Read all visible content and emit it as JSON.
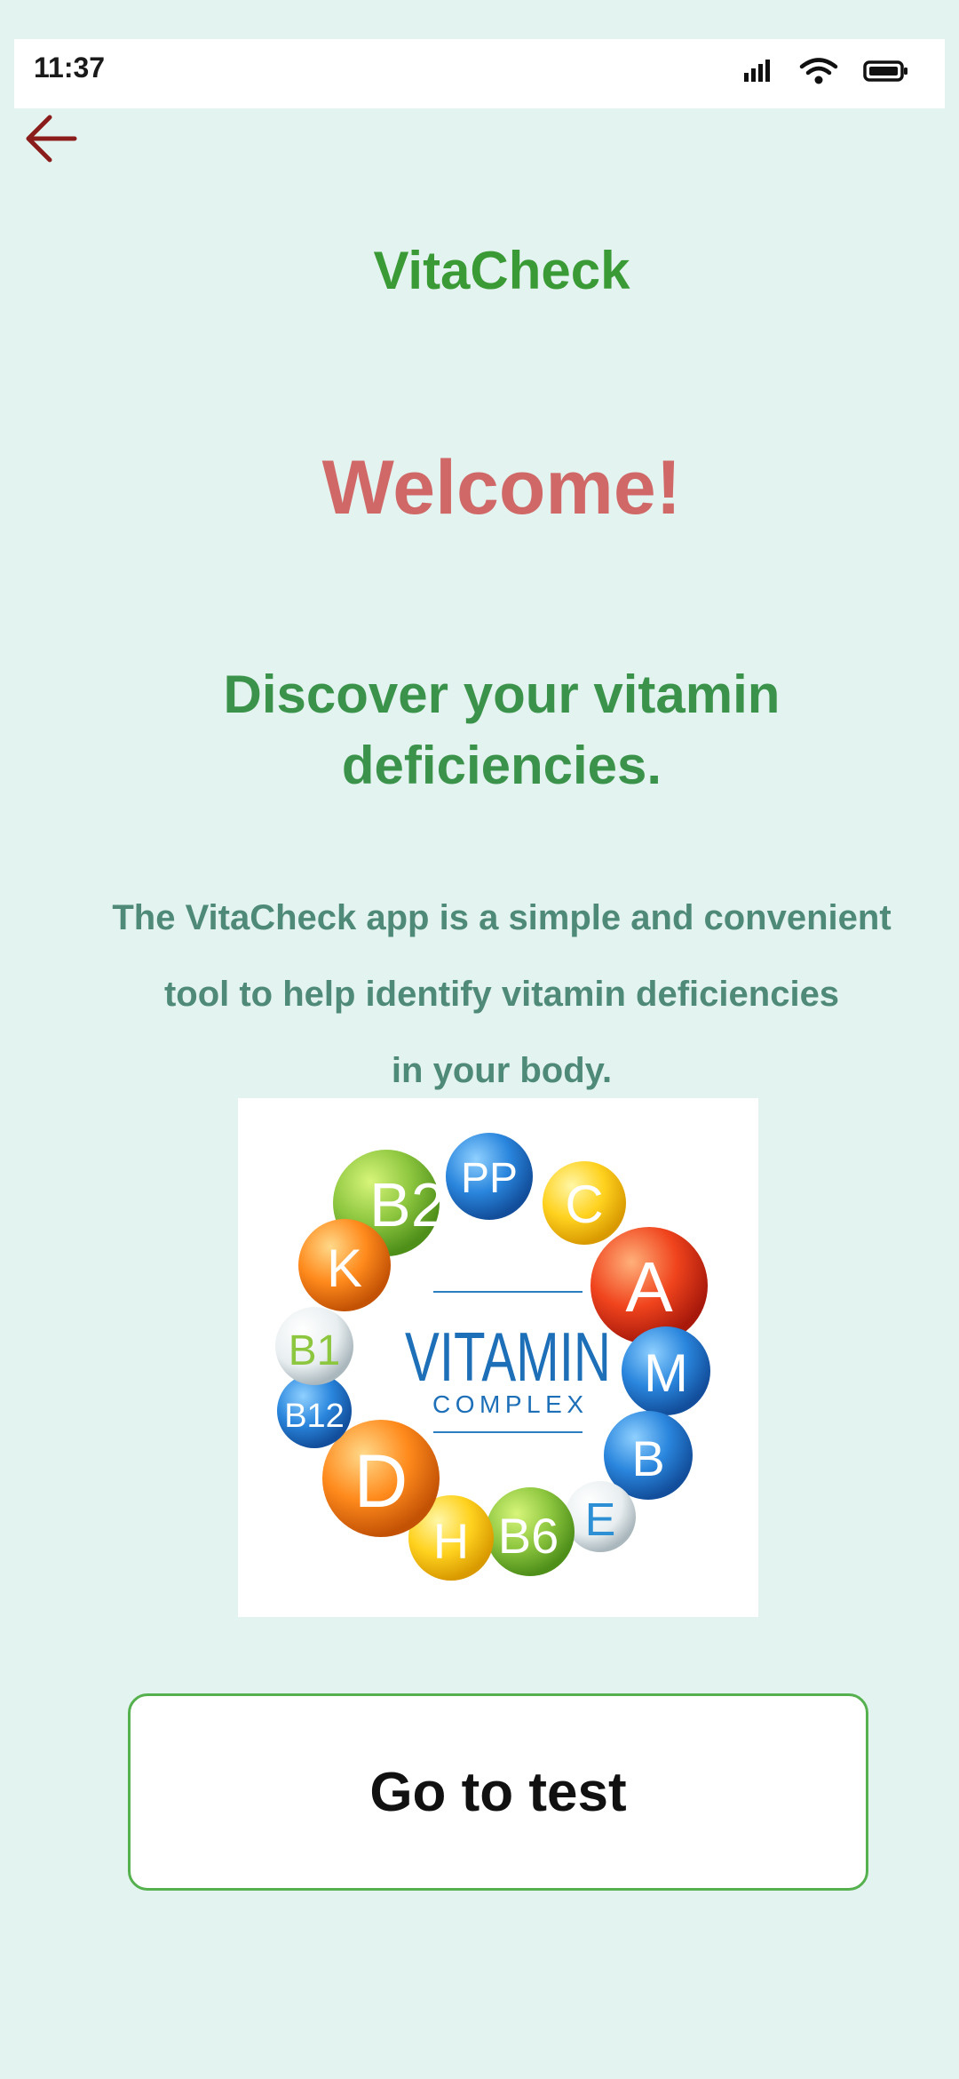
{
  "status_bar": {
    "time": "11:37",
    "icons": [
      "signal-icon",
      "wifi-icon",
      "battery-icon"
    ]
  },
  "nav": {
    "back_icon": "arrow-left-icon"
  },
  "header": {
    "app_name": "VitaCheck"
  },
  "main": {
    "welcome": "Welcome!",
    "headline": "Discover your vitamin deficiencies.",
    "description_lines": [
      "The VitaCheck app is a simple and convenient",
      "tool to help identify vitamin deficiencies",
      "in your body."
    ],
    "image": {
      "title": "VITAMIN",
      "subtitle": "COMPLEX",
      "balls": [
        "B2",
        "PP",
        "C",
        "A",
        "M",
        "B",
        "E",
        "B6",
        "H",
        "D",
        "B12",
        "B1",
        "K"
      ]
    },
    "cta_label": "Go to test"
  },
  "colors": {
    "background": "#e3f3ef",
    "app_name": "#3a9a36",
    "welcome": "#d06868",
    "headline": "#3b934b",
    "description": "#4e8a77",
    "button_border": "#55b04e",
    "back_arrow": "#8b1c1c"
  }
}
